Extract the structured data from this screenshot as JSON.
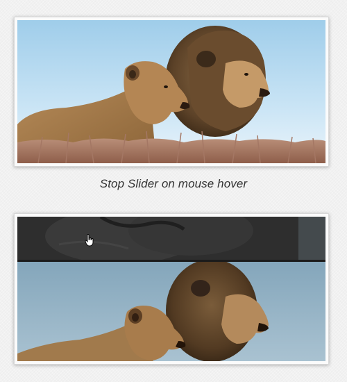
{
  "caption": "Stop Slider on mouse hover",
  "slides": [
    {
      "state": "normal",
      "icon": "lion-pair-image"
    },
    {
      "state": "transitioning",
      "icon": "lion-pair-image"
    }
  ],
  "colors": {
    "page_background": "#f1f1f1",
    "frame": "#fbfbfb",
    "sky_top": "#a8d2ec",
    "sky_bottom": "#e8f3fb",
    "sky_muted": "#88a9bd",
    "dark_strip": "#2f2f2f"
  },
  "cursor_icon": "hand-pointer-icon"
}
